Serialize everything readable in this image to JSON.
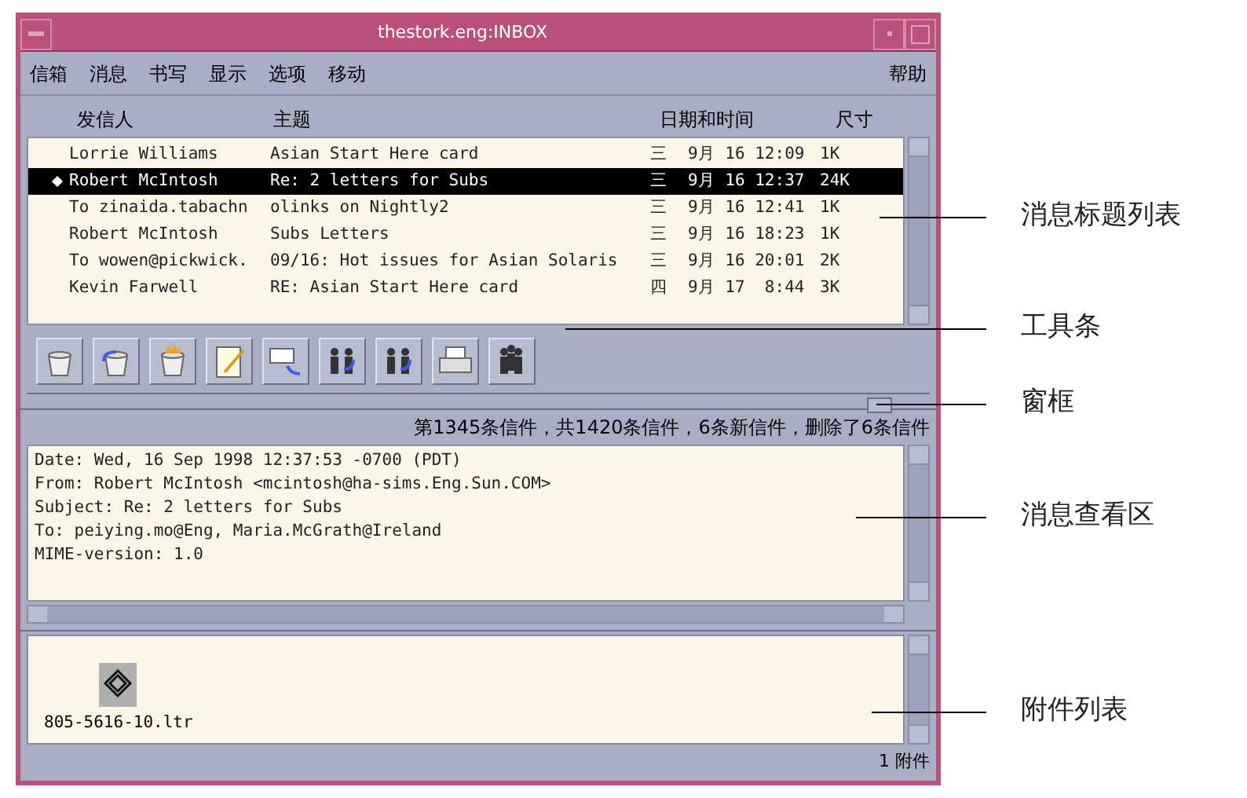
{
  "window": {
    "title": "thestork.eng:INBOX"
  },
  "menu": [
    "信箱",
    "消息",
    "书写",
    "显示",
    "选项",
    "移动"
  ],
  "help_menu": "帮助",
  "list_headers": {
    "sender": "发信人",
    "subject": "主题",
    "date": "日期和时间",
    "size": "尺寸"
  },
  "messages": [
    {
      "sender": "Lorrie Williams",
      "subject": "Asian Start Here card",
      "day": "三",
      "date": "9月 16 12:09",
      "size": "1K",
      "selected": false
    },
    {
      "sender": "Robert McIntosh",
      "subject": "Re: 2 letters for Subs",
      "day": "三",
      "date": "9月 16 12:37",
      "size": "24K",
      "selected": true
    },
    {
      "sender": "To zinaida.tabachn",
      "subject": "olinks on Nightly2",
      "day": "三",
      "date": "9月 16 12:41",
      "size": "1K",
      "selected": false
    },
    {
      "sender": "Robert McIntosh",
      "subject": "Subs Letters",
      "day": "三",
      "date": "9月 16 18:23",
      "size": "1K",
      "selected": false
    },
    {
      "sender": "To wowen@pickwick.",
      "subject": "09/16: Hot issues for Asian Solaris",
      "day": "三",
      "date": "9月 16 20:01",
      "size": "2K",
      "selected": false
    },
    {
      "sender": "Kevin Farwell",
      "subject": "RE: Asian Start Here card",
      "day": "四",
      "date": "9月 17  8:44",
      "size": "3K",
      "selected": false
    }
  ],
  "status": "第1345条信件，共1420条信件，6条新信件，删除了6条信件",
  "message_lines": [
    "Date: Wed, 16 Sep 1998 12:37:53 -0700 (PDT)",
    "From: Robert McIntosh <mcintosh@ha-sims.Eng.Sun.COM>",
    "Subject: Re: 2 letters for Subs",
    "To: peiying.mo@Eng, Maria.McGrath@Ireland",
    "MIME-version: 1.0"
  ],
  "attachments": [
    {
      "name": "805-5616-10.ltr"
    }
  ],
  "attachment_count": "1 附件",
  "callouts": [
    "消息标题列表",
    "工具条",
    "窗框",
    "消息查看区",
    "附件列表"
  ]
}
